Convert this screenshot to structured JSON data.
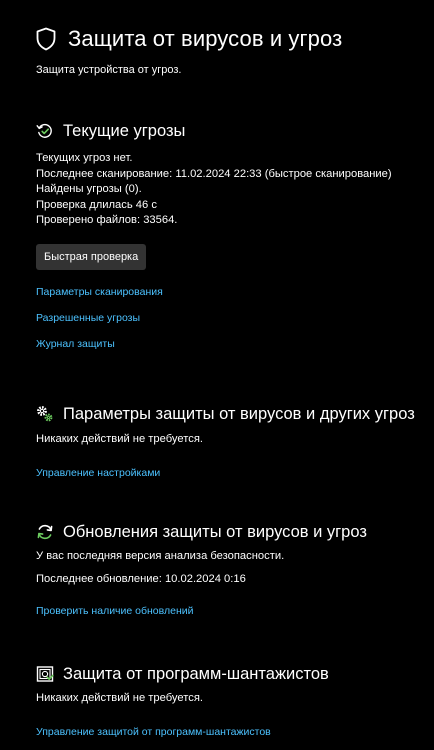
{
  "page": {
    "title": "Защита от вирусов и угроз",
    "subtitle": "Защита устройства от угроз.",
    "icon": "shield-icon"
  },
  "current_threats": {
    "icon": "scan-history-icon",
    "title": "Текущие угрозы",
    "lines": [
      "Текущих угроз нет.",
      "Последнее сканирование: 11.02.2024 22:33 (быстрое сканирование)",
      "Найдены угрозы (0).",
      "Проверка длилась 46 с",
      "Проверено файлов: 33564."
    ],
    "quick_scan_button": "Быстрая проверка",
    "links": [
      "Параметры сканирования",
      "Разрешенные угрозы",
      "Журнал защиты"
    ]
  },
  "protection_settings": {
    "icon": "settings-gears-icon",
    "title": "Параметры защиты от вирусов и других угроз",
    "status": "Никаких действий не требуется.",
    "link": "Управление настройками"
  },
  "updates": {
    "icon": "refresh-icon",
    "title": "Обновления защиты от вирусов и угроз",
    "status": "У вас последняя версия анализа безопасности.",
    "last_update": "Последнее обновление: 10.02.2024 0:16",
    "link": "Проверить наличие обновлений"
  },
  "ransomware": {
    "icon": "ransomware-protection-icon",
    "title": "Защита от программ-шантажистов",
    "status": "Никаких действий не требуется.",
    "link": "Управление защитой от программ-шантажистов"
  },
  "colors": {
    "background": "#000000",
    "text": "#ffffff",
    "link": "#4cc2ff",
    "button_bg": "#333333",
    "ok_green": "#6ccb5f"
  }
}
